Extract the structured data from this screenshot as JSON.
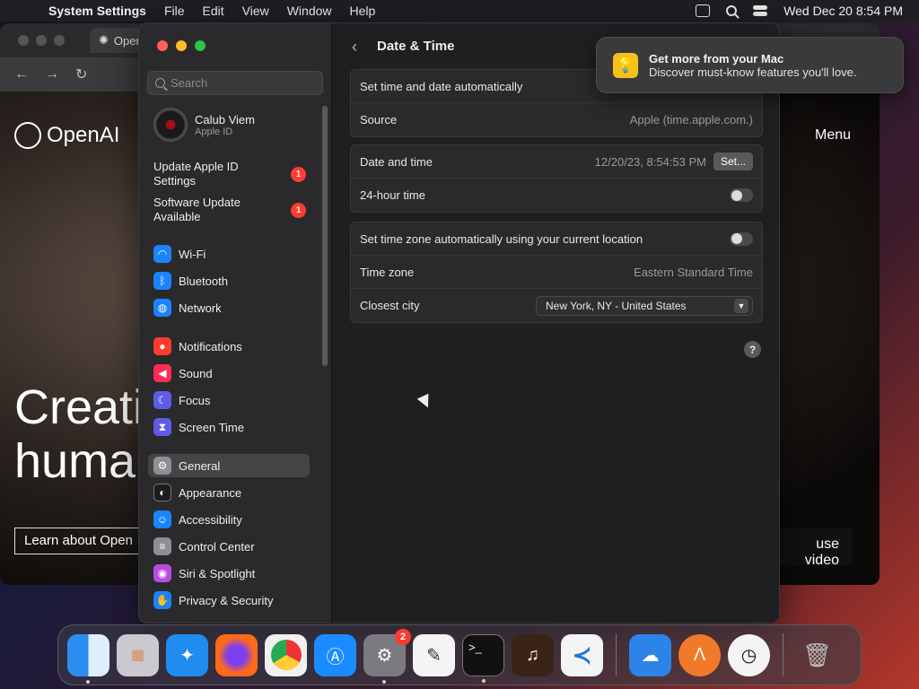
{
  "menubar": {
    "app": "System Settings",
    "items": [
      "File",
      "Edit",
      "View",
      "Window",
      "Help"
    ],
    "datetime": "Wed Dec 20  8:54 PM"
  },
  "browser": {
    "tab_title": "Open",
    "logo": "OpenAI",
    "menu": "Menu",
    "hero_line1": "Creati",
    "hero_line2": "huma",
    "learn": "Learn about Open",
    "pause": "use video"
  },
  "sidebar": {
    "search_placeholder": "Search",
    "account": {
      "name": "Calub Viem",
      "sub": "Apple ID"
    },
    "alerts": [
      {
        "label": "Update Apple ID Settings",
        "count": "1"
      },
      {
        "label": "Software Update Available",
        "count": "1"
      }
    ],
    "items": [
      {
        "label": "Wi-Fi",
        "color": "#1a84ff",
        "icon": "wifi-icon"
      },
      {
        "label": "Bluetooth",
        "color": "#1a84ff",
        "icon": "bluetooth-icon"
      },
      {
        "label": "Network",
        "color": "#1a84ff",
        "icon": "globe-icon"
      },
      {
        "label": "Notifications",
        "color": "#ff3b30",
        "icon": "bell-icon"
      },
      {
        "label": "Sound",
        "color": "#ff2d55",
        "icon": "speaker-icon"
      },
      {
        "label": "Focus",
        "color": "#5e5ce6",
        "icon": "moon-icon"
      },
      {
        "label": "Screen Time",
        "color": "#5e5ce6",
        "icon": "hourglass-icon"
      },
      {
        "label": "General",
        "color": "#8e8e93",
        "icon": "gear-icon"
      },
      {
        "label": "Appearance",
        "color": "#1c1c1e",
        "icon": "appearance-icon"
      },
      {
        "label": "Accessibility",
        "color": "#1a84ff",
        "icon": "accessibility-icon"
      },
      {
        "label": "Control Center",
        "color": "#8e8e93",
        "icon": "switches-icon"
      },
      {
        "label": "Siri & Spotlight",
        "color": "#b84be0",
        "icon": "siri-icon"
      },
      {
        "label": "Privacy & Security",
        "color": "#1a84ff",
        "icon": "hand-icon"
      }
    ]
  },
  "pane": {
    "title": "Date & Time",
    "group1": {
      "auto": "Set time and date automatically",
      "source_label": "Source",
      "source_value": "Apple (time.apple.com.)"
    },
    "group2": {
      "datetime_label": "Date and time",
      "datetime_value": "12/20/23, 8:54:53 PM",
      "set_button": "Set...",
      "hour24_label": "24-hour time"
    },
    "group3": {
      "tz_auto": "Set time zone automatically using your current location",
      "tz_label": "Time zone",
      "tz_value": "Eastern Standard Time",
      "city_label": "Closest city",
      "city_value": "New York, NY - United States"
    },
    "help": "?"
  },
  "notification": {
    "title": "Get more from your Mac",
    "body": "Discover must-know features you'll love."
  },
  "dock": {
    "settings_badge": "2"
  }
}
